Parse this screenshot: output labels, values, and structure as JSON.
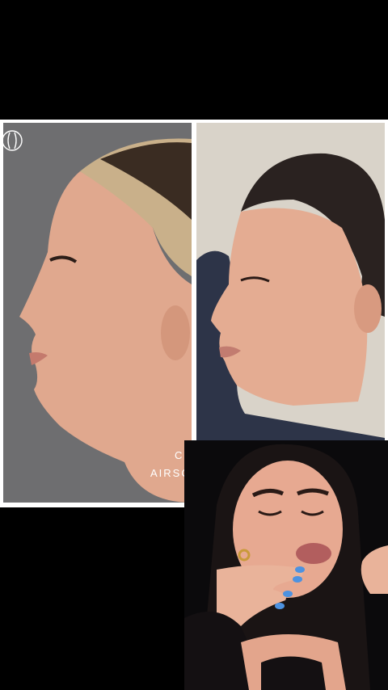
{
  "captions": {
    "line1": "CH",
    "line2": "AIRSC"
  },
  "colors": {
    "background": "#000000",
    "frame": "#ffffff",
    "before_bg": "#6e6e70",
    "after_bg": "#d9d3c9",
    "skin": "#e2a98f",
    "hair_dark": "#2a2220"
  },
  "icons": {
    "logo": "clinic-monogram-icon"
  }
}
